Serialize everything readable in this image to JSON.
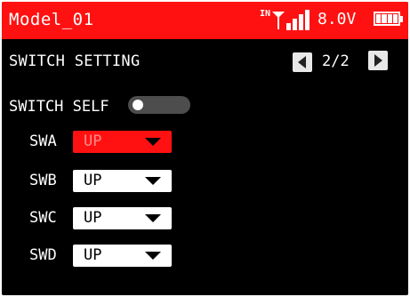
{
  "header": {
    "model_name": "Model_01",
    "signal_label": "IN",
    "voltage": "8.0V",
    "battery_level": 1.0,
    "header_color": "#ff1111"
  },
  "page": {
    "title": "SWITCH SETTING",
    "page_indicator": "2/2",
    "prev_icon": "triangle-left-icon",
    "next_icon": "triangle-right-icon"
  },
  "switch_self": {
    "label": "SWITCH SELF",
    "enabled": false
  },
  "switches": [
    {
      "name": "SWA",
      "value": "UP",
      "active": true
    },
    {
      "name": "SWB",
      "value": "UP",
      "active": false
    },
    {
      "name": "SWC",
      "value": "UP",
      "active": false
    },
    {
      "name": "SWD",
      "value": "UP",
      "active": false
    }
  ]
}
